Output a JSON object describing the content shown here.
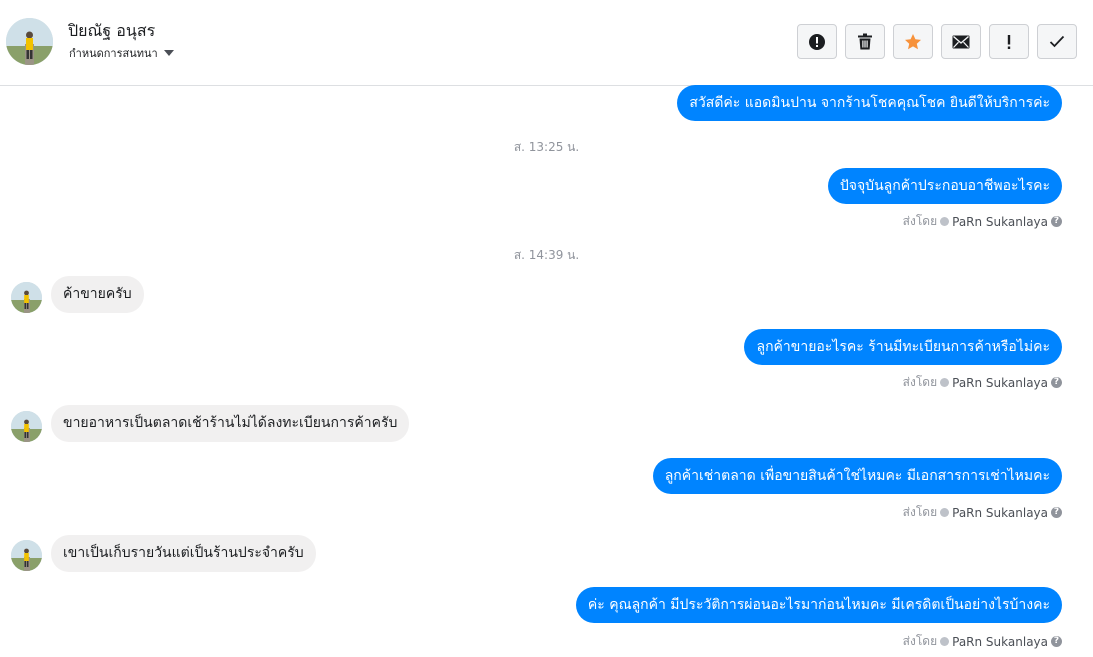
{
  "header": {
    "name": "ปิยณัฐ อนุสร",
    "subtitle": "กำหนดการสนทนา",
    "actions": [
      {
        "icon": "alert-circle-icon",
        "name": "report-button"
      },
      {
        "icon": "trash-icon",
        "name": "delete-button"
      },
      {
        "icon": "star-icon",
        "name": "star-button"
      },
      {
        "icon": "envelope-icon",
        "name": "mark-unread-button"
      },
      {
        "icon": "exclamation-icon",
        "name": "spam-button"
      },
      {
        "icon": "check-icon",
        "name": "mark-done-button"
      }
    ]
  },
  "colors": {
    "outgoing_bubble": "#0084ff",
    "incoming_bubble": "#f1f0f0",
    "star": "#f7923b"
  },
  "conversation": {
    "messages": [
      {
        "dir": "out",
        "text": "สวัสดีค่ะ แอดมินปาน จากร้านโชคคุณโชค ยินดีให้บริการค่ะ"
      },
      {
        "ts": "ส. 13:25 น."
      },
      {
        "dir": "out",
        "text": "ปัจจุบันลูกค้าประกอบอาชีพอะไรคะ"
      },
      {
        "sent_by_label": "ส่งโดย",
        "sender": "PaRn Sukanlaya"
      },
      {
        "ts": "ส. 14:39 น."
      },
      {
        "dir": "in",
        "text": "ค้าขายครับ"
      },
      {
        "dir": "out",
        "text": "ลูกค้าขายอะไรคะ ร้านมีทะเบียนการค้าหรือไม่คะ"
      },
      {
        "sent_by_label": "ส่งโดย",
        "sender": "PaRn Sukanlaya"
      },
      {
        "dir": "in",
        "text": "ขายอาหารเป็นตลาดเช้าร้านไม่ได้ลงทะเบียนการค้าครับ"
      },
      {
        "dir": "out",
        "text": "ลูกค้าเช่าตลาด เพื่อขายสินค้าใช่ไหมคะ มีเอกสารการเช่าไหมคะ"
      },
      {
        "sent_by_label": "ส่งโดย",
        "sender": "PaRn Sukanlaya"
      },
      {
        "dir": "in",
        "text": "เขาเป็นเก็บรายวันแต่เป็นร้านประจำครับ"
      },
      {
        "dir": "out",
        "text": "ค่ะ คุณลูกค้า มีประวัติการผ่อนอะไรมาก่อนไหมคะ มีเครดิตเป็นอย่างไรบ้างคะ"
      },
      {
        "sent_by_label": "ส่งโดย",
        "sender": "PaRn Sukanlaya"
      }
    ]
  }
}
